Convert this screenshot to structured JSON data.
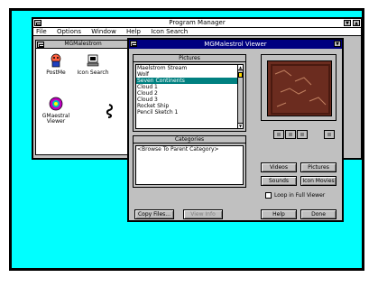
{
  "program_manager": {
    "title": "Program Manager",
    "menu": [
      "File",
      "Options",
      "Window",
      "Help",
      "Icon Search"
    ]
  },
  "group": {
    "title": "MGMalestrom",
    "icons": [
      {
        "label": "PostMe",
        "icon": "postme-icon"
      },
      {
        "label": "Icon Search",
        "icon": "icon-search-icon"
      },
      {
        "label": "GMaestral Viewer",
        "icon": "viewer-icon"
      },
      {
        "label": "",
        "icon": "seahorse-icon"
      }
    ]
  },
  "dialog": {
    "title": "MGMalestrol Viewer",
    "pictures_label": "Pictures",
    "pictures": [
      "Maelstrom Stream",
      "Wolf",
      "Seven Continents",
      "Cloud 1",
      "Cloud 2",
      "Cloud 3",
      "Rocket Ship",
      "Pencil Sketch 1"
    ],
    "selected_picture_index": 2,
    "categories_label": "Categories",
    "categories": [
      "<Browse To Parent Category>"
    ],
    "buttons": {
      "videos": "Videos",
      "pictures": "Pictures",
      "sounds": "Sounds",
      "icon_movies": "Icon Movies",
      "copy_files": "Copy Files...",
      "view_info": "View Info",
      "help": "Help",
      "done": "Done"
    },
    "checkbox_label": "Loop in Full Viewer",
    "checkbox_checked": false
  },
  "colors": {
    "desktop": "#00ffff",
    "title_active": "#000080",
    "selection": "#008080",
    "preview_bg": "#6b2c1f"
  }
}
